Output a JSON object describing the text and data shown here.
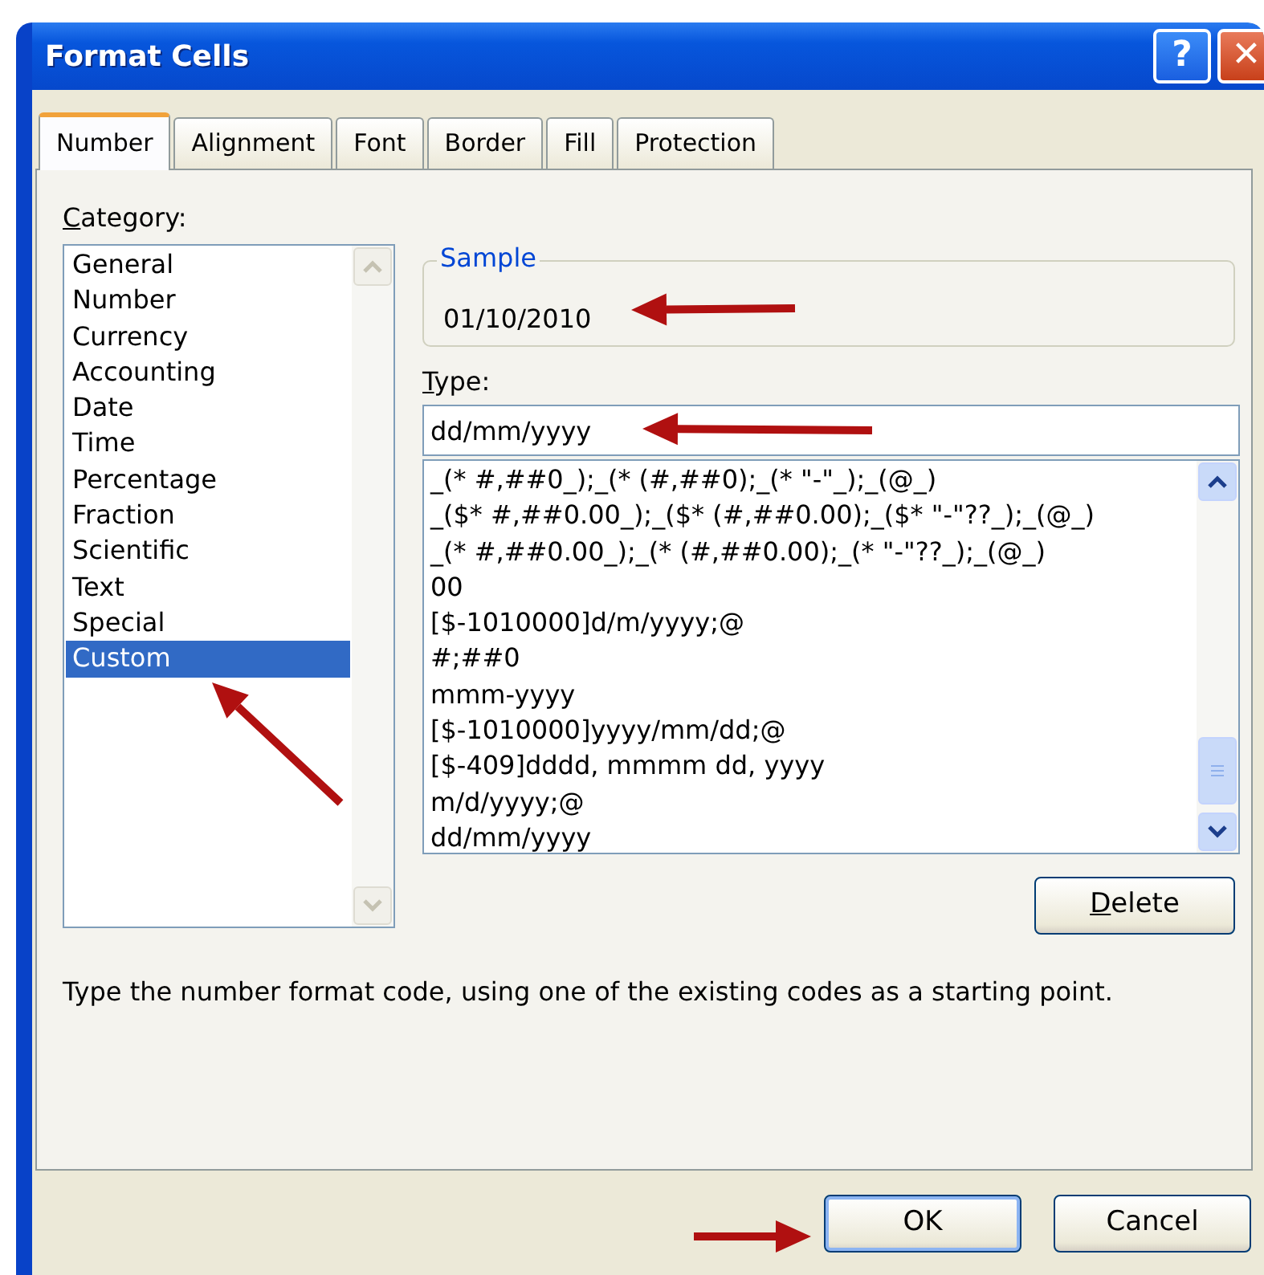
{
  "window": {
    "title": "Format Cells",
    "help_button": "?",
    "close_button": "✕"
  },
  "tabs": [
    {
      "label": "Number",
      "selected": true
    },
    {
      "label": "Alignment",
      "selected": false
    },
    {
      "label": "Font",
      "selected": false
    },
    {
      "label": "Border",
      "selected": false
    },
    {
      "label": "Fill",
      "selected": false
    },
    {
      "label": "Protection",
      "selected": false
    }
  ],
  "category": {
    "label": "Category:",
    "mnemonic": true,
    "items": [
      {
        "label": "General",
        "selected": false
      },
      {
        "label": "Number",
        "selected": false
      },
      {
        "label": "Currency",
        "selected": false
      },
      {
        "label": "Accounting",
        "selected": false
      },
      {
        "label": "Date",
        "selected": false
      },
      {
        "label": "Time",
        "selected": false
      },
      {
        "label": "Percentage",
        "selected": false
      },
      {
        "label": "Fraction",
        "selected": false
      },
      {
        "label": "Scientific",
        "selected": false
      },
      {
        "label": "Text",
        "selected": false
      },
      {
        "label": "Special",
        "selected": false
      },
      {
        "label": "Custom",
        "selected": true
      }
    ]
  },
  "sample": {
    "label": "Sample",
    "value": "01/10/2010"
  },
  "type": {
    "label": "Type:",
    "mnemonic": true,
    "value": "dd/mm/yyyy"
  },
  "formats": [
    "_(* #,##0_);_(* (#,##0);_(* \"-\"_);_(@_)",
    "_($* #,##0.00_);_($* (#,##0.00);_($* \"-\"??_);_(@_)",
    "_(* #,##0.00_);_(* (#,##0.00);_(* \"-\"??_);_(@_)",
    "00",
    "[$-1010000]d/m/yyyy;@",
    "#;##0",
    "mmm-yyyy",
    "[$-1010000]yyyy/mm/dd;@",
    "[$-409]dddd, mmmm dd, yyyy",
    "m/d/yyyy;@",
    "dd/mm/yyyy"
  ],
  "delete_button": {
    "label": "Delete",
    "mnemonic": true
  },
  "description": "Type the number format code, using one of the existing codes as a starting point.",
  "buttons": [
    {
      "label": "OK",
      "default": true
    },
    {
      "label": "Cancel",
      "default": false
    }
  ]
}
